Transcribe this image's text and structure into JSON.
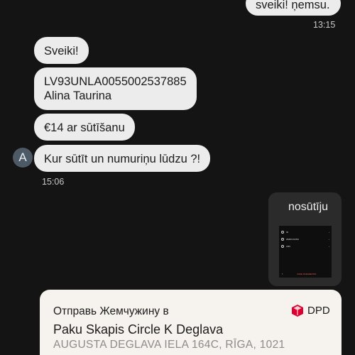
{
  "messages": {
    "top_outgoing": "sveiki! ņemsu.",
    "top_time": "13:15",
    "greeting": "Sveiki!",
    "account_line1": "LV93UNLA0055002537885",
    "account_line2": "Alina Taurina",
    "price": "€14 ar sūtīšanu",
    "question": "Kur sūtīt un numuriņu lūdzu ?!",
    "incoming_time": "15:06",
    "avatar_letter": "A"
  },
  "image_message": {
    "caption": "nosūtīju",
    "rows": [
      {
        "text": "ID",
        "arrow": "›"
      },
      {
        "text": "ZEMCUGINU",
        "arrow": "›"
      },
      {
        "text": "LBN",
        "arrow": "›"
      }
    ],
    "back": "‹",
    "cta": "SAVE PARAMETRS"
  },
  "dpd_card": {
    "header": "Отправь Жемчужину в",
    "brand": "DPD",
    "brand_color": "#dc0032",
    "title": "Paku Skapis Circle K Deglava",
    "address": "AUGUSTA DEGLAVA IELA 164C, RĪGA, 1021"
  }
}
